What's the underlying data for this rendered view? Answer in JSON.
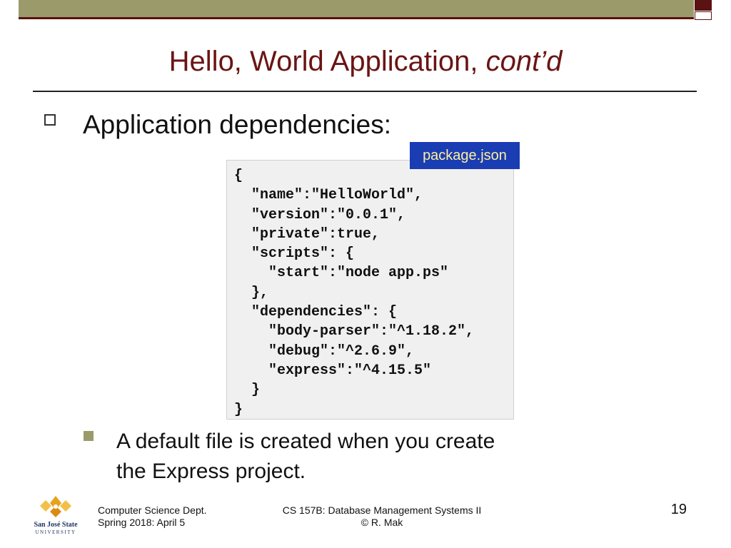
{
  "slide": {
    "title_main": "Hello, World Application, ",
    "title_italic": "cont’d",
    "bullet1": "Application dependencies:",
    "file_tag": "package.json",
    "code_lines": [
      "{",
      "  \"name\":\"HelloWorld\",",
      "  \"version\":\"0.0.1\",",
      "  \"private\":true,",
      "  \"scripts\": {",
      "    \"start\":\"node app.ps\"",
      "  },",
      "  \"dependencies\": {",
      "    \"body-parser\":\"^1.18.2\",",
      "    \"debug\":\"^2.6.9\",",
      "    \"express\":\"^4.15.5\"",
      "  }",
      "}"
    ],
    "bullet2_line1": "A default file is created when you create",
    "bullet2_line2": "the Express project."
  },
  "footer": {
    "left_line1": "Computer Science Dept.",
    "left_line2": "Spring 2018: April 5",
    "center_line1": "CS 157B: Database Management Systems II",
    "center_line2": "© R. Mak",
    "page_number": "19",
    "logo_text_line1": "San José State",
    "logo_text_line2": "UNIVERSITY"
  },
  "colors": {
    "title": "#6b1414",
    "accent_olive": "#9b9a6a",
    "accent_maroon": "#5a1212",
    "tag_bg": "#1a3db4",
    "tag_text": "#ffef9c",
    "logo_gold": "#e8a21e",
    "logo_navy": "#1f3566"
  },
  "icons": {
    "logo": "sjsu-logo-icon"
  }
}
